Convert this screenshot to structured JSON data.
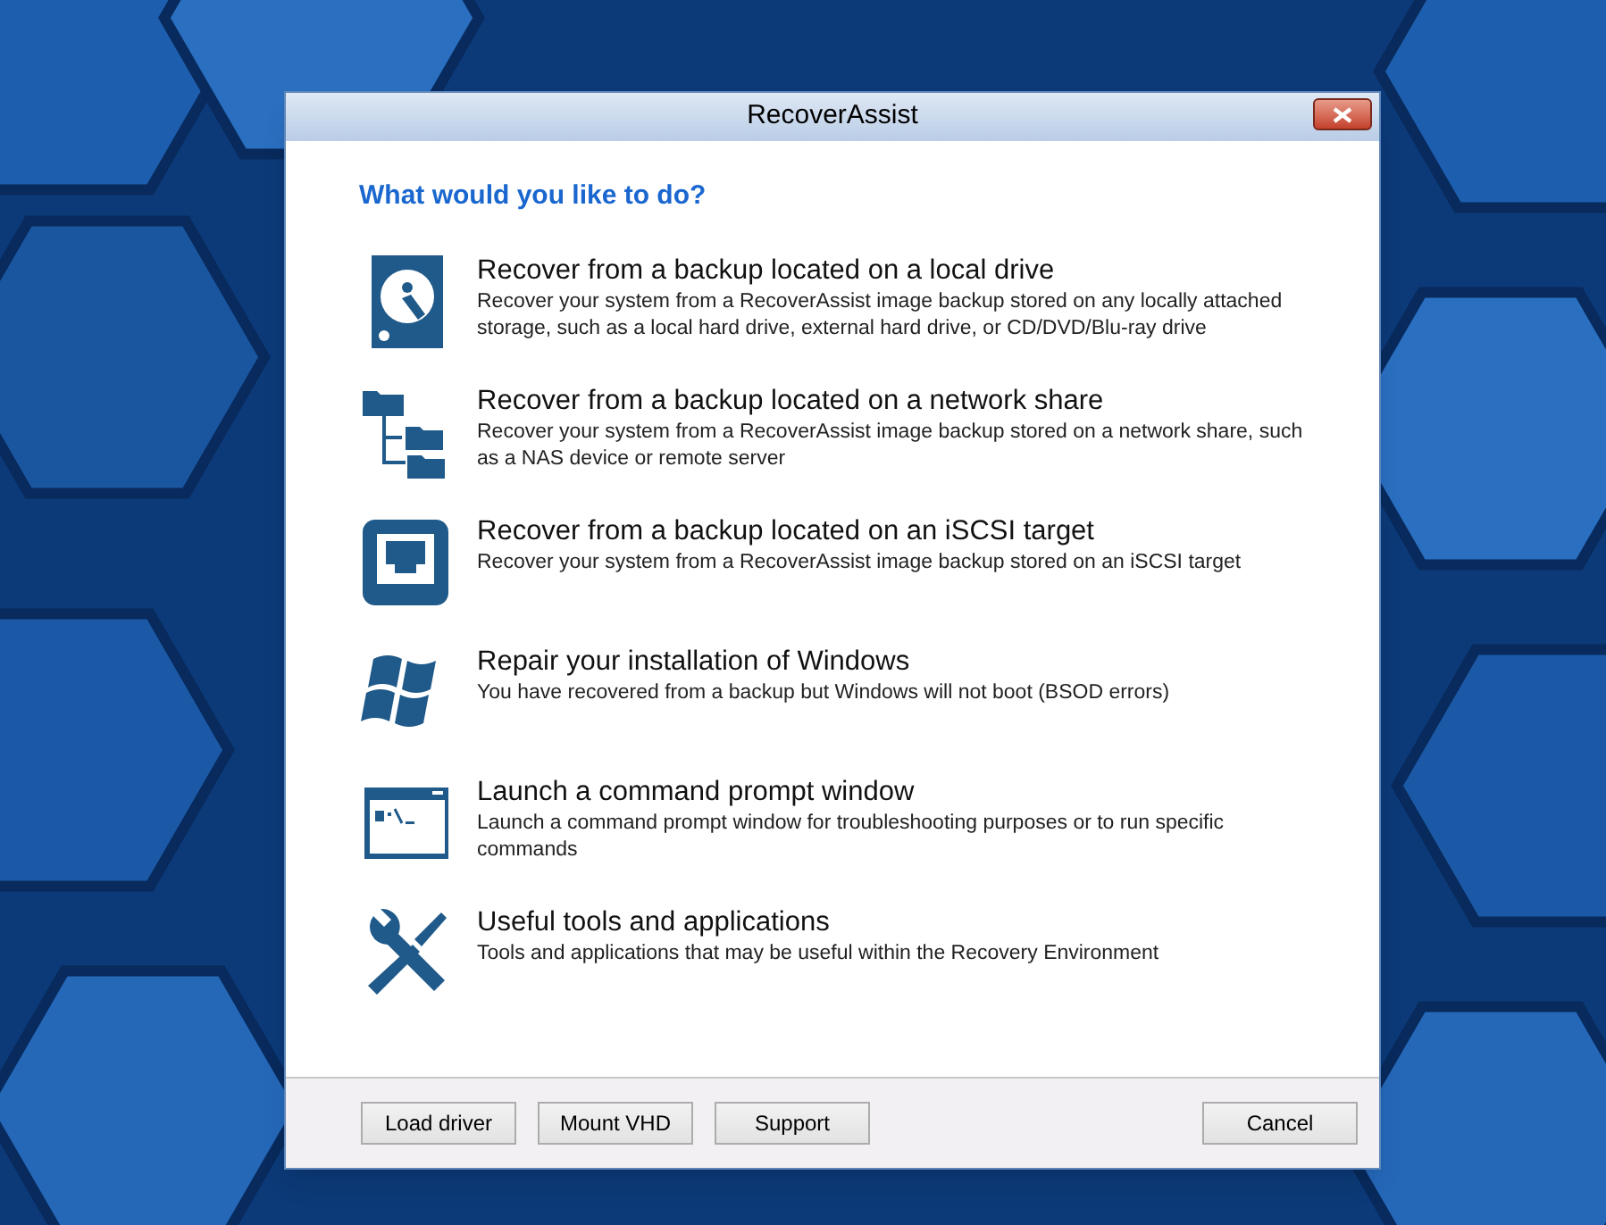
{
  "window": {
    "title": "RecoverAssist"
  },
  "heading": "What would you like to do?",
  "options": [
    {
      "kind": "local-drive",
      "title": "Recover from a backup located on a local drive",
      "description": "Recover your system from a RecoverAssist image backup stored on any locally attached storage, such as a local hard drive, external hard drive, or CD/DVD/Blu-ray drive"
    },
    {
      "kind": "network-share",
      "title": "Recover from a backup located on a network share",
      "description": "Recover your system from a RecoverAssist image backup stored on a network share, such as a NAS device or remote server"
    },
    {
      "kind": "iscsi",
      "title": "Recover from a backup located on an iSCSI target",
      "description": "Recover your system from a RecoverAssist image backup stored on an iSCSI target"
    },
    {
      "kind": "windows",
      "title": "Repair your installation of Windows",
      "description": "You have recovered from a backup but Windows will not boot (BSOD errors)"
    },
    {
      "kind": "command-prompt",
      "title": "Launch a command prompt window",
      "description": "Launch a command prompt window for troubleshooting purposes or to run specific commands"
    },
    {
      "kind": "tools",
      "title": "Useful tools and applications",
      "description": "Tools and applications that may be useful within the Recovery Environment"
    }
  ],
  "footer_buttons": [
    "Load driver",
    "Mount VHD",
    "Support"
  ],
  "cancel_button": "Cancel"
}
